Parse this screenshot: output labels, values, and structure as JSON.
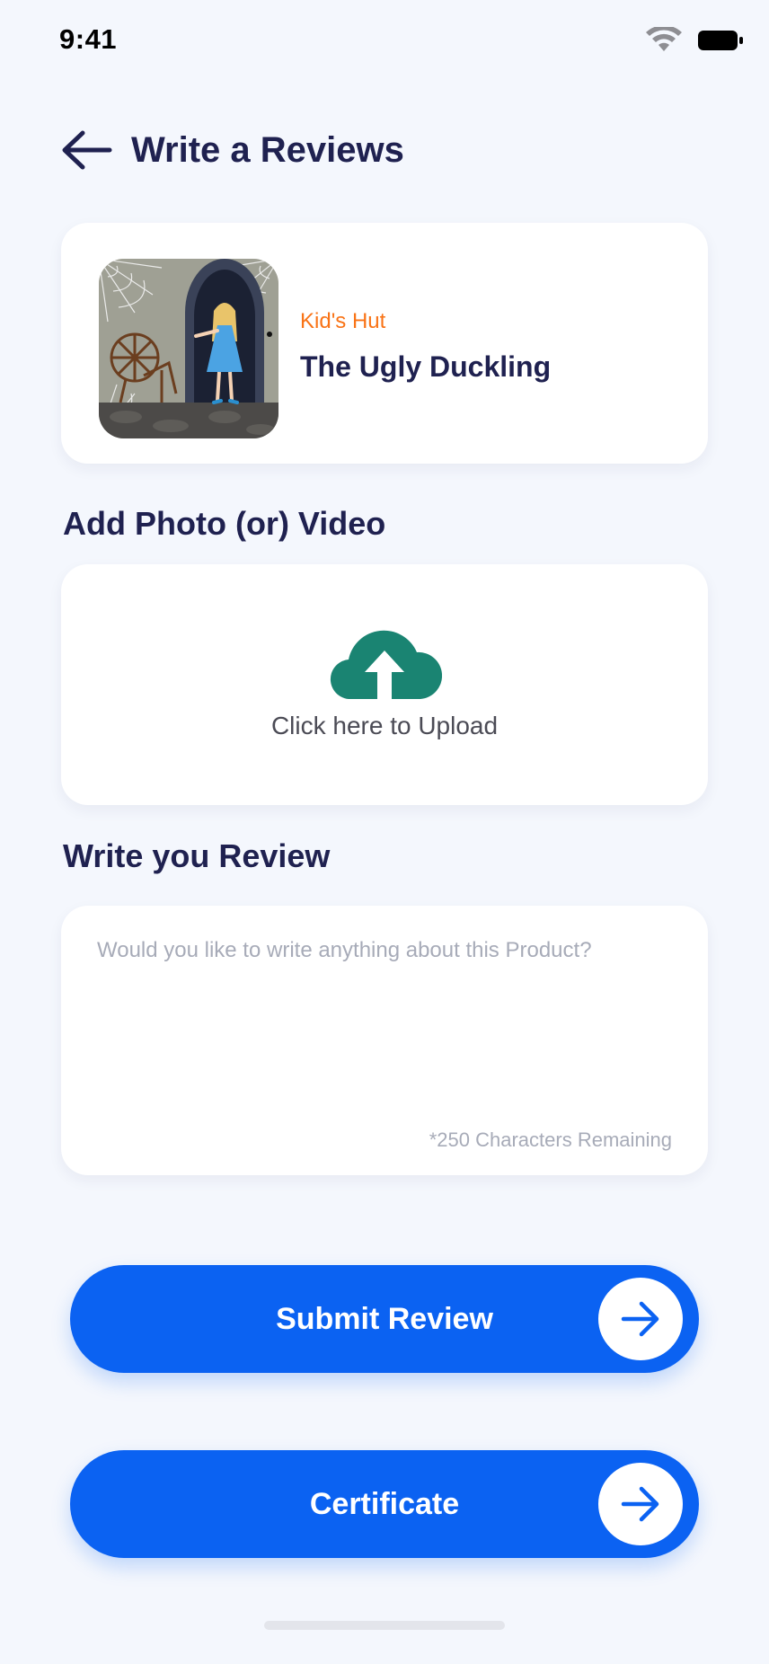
{
  "status_bar": {
    "time": "9:41"
  },
  "header": {
    "title": "Write a Reviews"
  },
  "product": {
    "brand": "Kid's Hut",
    "name": "The Ugly Duckling"
  },
  "upload": {
    "section_title": "Add Photo (or) Video",
    "label": "Click here to Upload"
  },
  "review": {
    "section_title": "Write you Review",
    "value": "",
    "placeholder": "Would you like to write anything about this Product?",
    "remaining": "*250 Characters Remaining"
  },
  "buttons": {
    "submit_label": "Submit Review",
    "certificate_label": "Certificate"
  },
  "colors": {
    "primary": "#0B62F2",
    "brand_orange": "#F97316",
    "upload_green": "#1A8472",
    "title_navy": "#1F2150",
    "background": "#F4F7FD"
  },
  "icons": {
    "back": "arrow-left-icon",
    "upload": "cloud-upload-icon",
    "button_arrow": "arrow-right-icon",
    "wifi": "wifi-icon",
    "battery": "battery-icon"
  }
}
